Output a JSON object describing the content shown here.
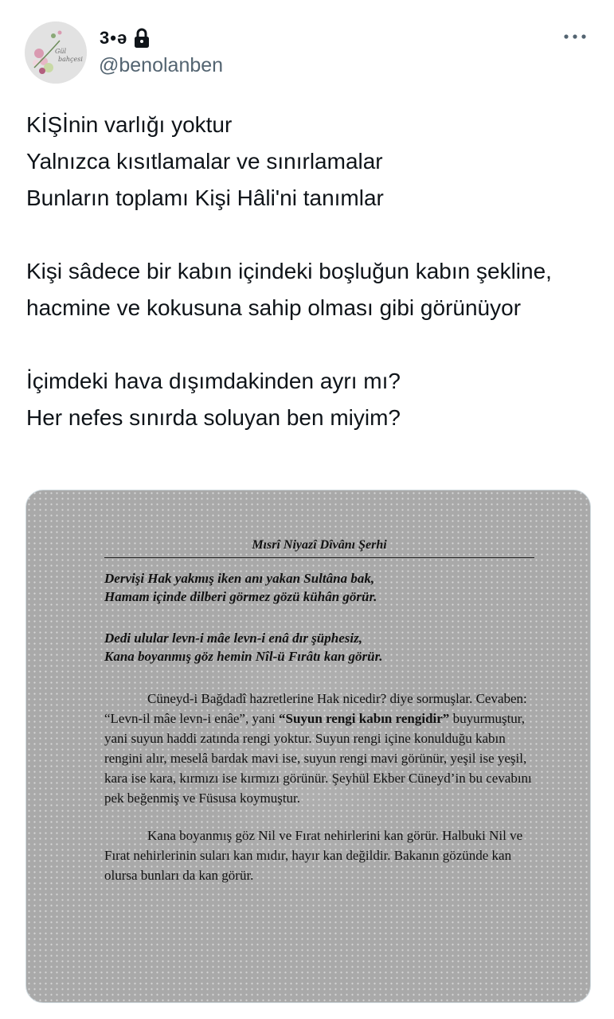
{
  "author": {
    "display_name": "3•ə",
    "handle": "@benolanben",
    "avatar_text_1": "Gül",
    "avatar_text_2": "bahçesi"
  },
  "tweet": {
    "lines": [
      "KİŞİnin varlığı yoktur",
      "Yalnızca kısıtlamalar ve sınırlamalar",
      "Bunların toplamı Kişi Hâli'ni tanımlar",
      "",
      "Kişi sâdece bir kabın içindeki boşluğun kabın şekline, hacmine ve kokusuna sahip olması gibi görünüyor",
      "",
      "İçimdeki hava dışımdakinden ayrı mı?",
      "Her nefes sınırda soluyan ben miyim?"
    ]
  },
  "book_page": {
    "title": "Mısrî Niyazî Dîvânı Şerhi",
    "verse1_line1": "Dervişi Hak yakmış iken anı yakan Sultâna bak,",
    "verse1_line2": "Hamam içinde dilberi görmez gözü kühân görür.",
    "verse2_line1": "Dedi ulular levn-i mâe levn-i enâ dır şüphesiz,",
    "verse2_line2": "Kana boyanmış göz hemin Nîl-ü Fırâtı kan görür.",
    "para1_a": "Cüneyd-i Bağdadî hazretlerine Hak nicedir? diye sormuşlar. Cevaben: “Levn-il mâe levn-i enâe”, yani ",
    "para1_bold": "“Suyun rengi kabın rengidir”",
    "para1_b": " buyurmuştur, yani suyun haddi zatında rengi yoktur. Suyun rengi içine konulduğu kabın rengini alır, meselâ bardak mavi ise, suyun rengi mavi görünür, yeşil ise yeşil, kara ise kara, kırmızı ise kırmızı görünür. Şeyhül Ekber Cüneyd’in bu cevabını pek beğenmiş ve Füsusa koymuştur.",
    "para2": "Kana boyanmış göz Nil ve Fırat nehirlerini kan görür. Halbuki Nil ve Fırat nehirlerinin suları kan mıdır, hayır kan değildir. Bakanın gözünde kan olursa bunları da kan görür."
  },
  "icons": {
    "lock": "lock-icon",
    "more": "more-icon"
  },
  "colors": {
    "text": "#0f1419",
    "secondary": "#536471",
    "media_bg": "#a9a9a9"
  }
}
